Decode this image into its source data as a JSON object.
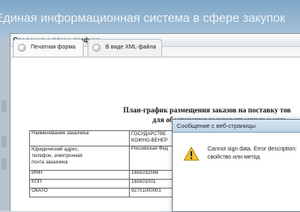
{
  "background": {
    "portal_title": "Единая информационная система в сфере закупок"
  },
  "window": {
    "title": "Сведения о плане-графике",
    "tabs": [
      {
        "label": "Печатная форма",
        "active": true
      },
      {
        "label": "В виде XML-файла",
        "active": false
      }
    ]
  },
  "document": {
    "title_line1": "План-график размещения заказов на поставку тов",
    "title_line2": "для обеспечения государственных и мун",
    "rows": [
      {
        "label": "Наименование заказчика",
        "value": "ГОСУДАРСТВЕ\nКОЖНО-ВЕНЕР"
      },
      {
        "label": "Юридический адрес,\nтелефон, электронная\nпочта заказчика",
        "value": "Российская Фед"
      },
      {
        "label": "ИНН",
        "value": "1655032566"
      },
      {
        "label": "КПП",
        "value": "165501001"
      },
      {
        "label": "ОКАТО",
        "value": "92701000001"
      }
    ]
  },
  "dialog": {
    "title": "Сообщение с веб-страницы",
    "icon": "warning-icon",
    "message_line1": "Cannot sign data. Error description:",
    "message_line2": "свойство или метод"
  },
  "colors": {
    "header": "#7fa7c6",
    "dialog_title": "#bcd0e2",
    "warning": "#f2c230"
  }
}
